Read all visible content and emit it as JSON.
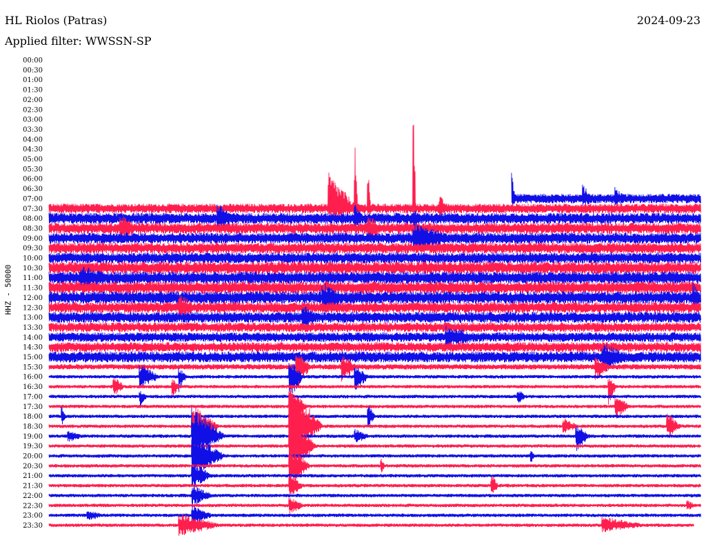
{
  "header": {
    "station": "HL Riolos (Patras)",
    "filter": "Applied filter: WWSSN-SP",
    "date": "2024-09-23"
  },
  "axis_label": "HHZ - 50000",
  "colors": {
    "odd_rows": "#ff1f4f",
    "even_rows": "#1010e6",
    "background": "#ffffff",
    "text": "#000000"
  },
  "chart_data": {
    "type": "line",
    "subtype": "helicorder",
    "title": "HL Riolos (Patras)",
    "subtitle": "Applied filter: WWSSN-SP",
    "date": "2024-09-23",
    "ylabel": "HHZ - 50000",
    "rows": [
      {
        "label": "00:00",
        "active": false,
        "amp": 0,
        "events": []
      },
      {
        "label": "00:30",
        "active": false,
        "amp": 0,
        "events": []
      },
      {
        "label": "01:00",
        "active": false,
        "amp": 0,
        "events": []
      },
      {
        "label": "01:30",
        "active": false,
        "amp": 0,
        "events": []
      },
      {
        "label": "02:00",
        "active": false,
        "amp": 0,
        "events": []
      },
      {
        "label": "02:30",
        "active": false,
        "amp": 0,
        "events": []
      },
      {
        "label": "03:00",
        "active": false,
        "amp": 0,
        "events": []
      },
      {
        "label": "03:30",
        "active": false,
        "amp": 0,
        "events": []
      },
      {
        "label": "04:00",
        "active": false,
        "amp": 0,
        "events": []
      },
      {
        "label": "04:30",
        "active": false,
        "amp": 0,
        "events": []
      },
      {
        "label": "05:00",
        "active": false,
        "amp": 0,
        "events": []
      },
      {
        "label": "05:30",
        "active": false,
        "amp": 0,
        "events": []
      },
      {
        "label": "06:00",
        "active": false,
        "amp": 0,
        "events": []
      },
      {
        "label": "06:30",
        "active": false,
        "amp": 0,
        "events": []
      },
      {
        "label": "07:00",
        "active": true,
        "start": 0.71,
        "amp": 7,
        "events": [
          {
            "t": 0.71,
            "up": 40,
            "down": 4,
            "dur": 0.005
          },
          {
            "t": 0.82,
            "up": 14,
            "down": 4,
            "dur": 0.01
          },
          {
            "t": 0.87,
            "up": 10,
            "down": 4,
            "dur": 0.01
          }
        ]
      },
      {
        "label": "07:30",
        "active": true,
        "amp": 7,
        "events": [
          {
            "t": 0.43,
            "up": 45,
            "down": 8,
            "dur": 0.04
          },
          {
            "t": 0.47,
            "up": 82,
            "down": 6,
            "dur": 0.004
          },
          {
            "t": 0.49,
            "up": 56,
            "down": 6,
            "dur": 0.004
          },
          {
            "t": 0.56,
            "up": 145,
            "down": 6,
            "dur": 0.003
          },
          {
            "t": 0.6,
            "up": 12,
            "down": 6,
            "dur": 0.01
          }
        ]
      },
      {
        "label": "08:00",
        "active": true,
        "amp": 8,
        "events": [
          {
            "t": 0.26,
            "up": 14,
            "down": 12,
            "dur": 0.02
          },
          {
            "t": 0.47,
            "up": 12,
            "down": 14,
            "dur": 0.01
          },
          {
            "t": 0.56,
            "up": 10,
            "down": 40,
            "dur": 0.005
          }
        ]
      },
      {
        "label": "08:30",
        "active": true,
        "amp": 8,
        "events": [
          {
            "t": 0.11,
            "up": 12,
            "down": 12,
            "dur": 0.02
          },
          {
            "t": 0.49,
            "up": 10,
            "down": 10,
            "dur": 0.02
          }
        ]
      },
      {
        "label": "09:00",
        "active": true,
        "amp": 8,
        "events": [
          {
            "t": 0.56,
            "up": 14,
            "down": 14,
            "dur": 0.05
          }
        ]
      },
      {
        "label": "09:30",
        "active": true,
        "amp": 8,
        "events": []
      },
      {
        "label": "10:00",
        "active": true,
        "amp": 8,
        "events": []
      },
      {
        "label": "10:30",
        "active": true,
        "amp": 9,
        "events": []
      },
      {
        "label": "11:00",
        "active": true,
        "amp": 9,
        "events": [
          {
            "t": 0.05,
            "up": 10,
            "down": 10,
            "dur": 0.03
          }
        ]
      },
      {
        "label": "11:30",
        "active": true,
        "amp": 9,
        "events": []
      },
      {
        "label": "12:00",
        "active": true,
        "amp": 9,
        "events": [
          {
            "t": 0.42,
            "up": 14,
            "down": 18,
            "dur": 0.03
          },
          {
            "t": 0.99,
            "up": 12,
            "down": 14,
            "dur": 0.01
          }
        ]
      },
      {
        "label": "12:30",
        "active": true,
        "amp": 8,
        "events": [
          {
            "t": 0.2,
            "up": 12,
            "down": 10,
            "dur": 0.02
          }
        ]
      },
      {
        "label": "13:00",
        "active": true,
        "amp": 8,
        "events": [
          {
            "t": 0.39,
            "up": 10,
            "down": 12,
            "dur": 0.02
          }
        ]
      },
      {
        "label": "13:30",
        "active": true,
        "amp": 7,
        "events": []
      },
      {
        "label": "14:00",
        "active": true,
        "amp": 7,
        "events": [
          {
            "t": 0.61,
            "up": 10,
            "down": 8,
            "dur": 0.04
          }
        ]
      },
      {
        "label": "14:30",
        "active": true,
        "amp": 7,
        "events": []
      },
      {
        "label": "15:00",
        "active": true,
        "amp": 8,
        "events": [
          {
            "t": 0.85,
            "up": 14,
            "down": 18,
            "dur": 0.03
          }
        ]
      },
      {
        "label": "15:30",
        "active": true,
        "amp": 4,
        "events": [
          {
            "t": 0.38,
            "up": 22,
            "down": 32,
            "dur": 0.02
          },
          {
            "t": 0.45,
            "up": 14,
            "down": 18,
            "dur": 0.02
          },
          {
            "t": 0.84,
            "up": 10,
            "down": 16,
            "dur": 0.02
          }
        ]
      },
      {
        "label": "16:00",
        "active": true,
        "amp": 2.5,
        "events": [
          {
            "t": 0.14,
            "up": 16,
            "down": 14,
            "dur": 0.03
          },
          {
            "t": 0.2,
            "up": 12,
            "down": 20,
            "dur": 0.01
          },
          {
            "t": 0.37,
            "up": 24,
            "down": 30,
            "dur": 0.02
          },
          {
            "t": 0.47,
            "up": 14,
            "down": 20,
            "dur": 0.02
          }
        ]
      },
      {
        "label": "16:30",
        "active": true,
        "amp": 2.5,
        "events": [
          {
            "t": 0.1,
            "up": 14,
            "down": 10,
            "dur": 0.015
          },
          {
            "t": 0.19,
            "up": 10,
            "down": 12,
            "dur": 0.01
          },
          {
            "t": 0.86,
            "up": 12,
            "down": 24,
            "dur": 0.01
          }
        ]
      },
      {
        "label": "17:00",
        "active": true,
        "amp": 2.5,
        "events": [
          {
            "t": 0.14,
            "up": 6,
            "down": 12,
            "dur": 0.01
          },
          {
            "t": 0.72,
            "up": 10,
            "down": 10,
            "dur": 0.01
          }
        ]
      },
      {
        "label": "17:30",
        "active": true,
        "amp": 2.5,
        "events": [
          {
            "t": 0.37,
            "up": 22,
            "down": 30,
            "dur": 0.025
          },
          {
            "t": 0.87,
            "up": 16,
            "down": 16,
            "dur": 0.02
          }
        ]
      },
      {
        "label": "18:00",
        "active": true,
        "amp": 2.5,
        "events": [
          {
            "t": 0.02,
            "up": 12,
            "down": 12,
            "dur": 0.005
          },
          {
            "t": 0.49,
            "up": 16,
            "down": 14,
            "dur": 0.01
          }
        ]
      },
      {
        "label": "18:30",
        "active": true,
        "amp": 2.5,
        "events": [
          {
            "t": 0.22,
            "up": 30,
            "down": 24,
            "dur": 0.04
          },
          {
            "t": 0.37,
            "up": 60,
            "down": 40,
            "dur": 0.05
          },
          {
            "t": 0.79,
            "up": 10,
            "down": 8,
            "dur": 0.02
          },
          {
            "t": 0.95,
            "up": 16,
            "down": 14,
            "dur": 0.02
          }
        ]
      },
      {
        "label": "19:00",
        "active": true,
        "amp": 2.5,
        "events": [
          {
            "t": 0.03,
            "up": 6,
            "down": 6,
            "dur": 0.02
          },
          {
            "t": 0.22,
            "up": 40,
            "down": 30,
            "dur": 0.05
          },
          {
            "t": 0.47,
            "up": 8,
            "down": 8,
            "dur": 0.02
          },
          {
            "t": 0.81,
            "up": 14,
            "down": 20,
            "dur": 0.02
          }
        ]
      },
      {
        "label": "19:30",
        "active": true,
        "amp": 2.5,
        "events": [
          {
            "t": 0.37,
            "up": 40,
            "down": 40,
            "dur": 0.04
          }
        ]
      },
      {
        "label": "20:00",
        "active": true,
        "amp": 2.5,
        "events": [
          {
            "t": 0.22,
            "up": 30,
            "down": 30,
            "dur": 0.05
          },
          {
            "t": 0.74,
            "up": 8,
            "down": 8,
            "dur": 0.005
          }
        ]
      },
      {
        "label": "20:30",
        "active": true,
        "amp": 2.5,
        "events": [
          {
            "t": 0.37,
            "up": 24,
            "down": 30,
            "dur": 0.03
          },
          {
            "t": 0.51,
            "up": 8,
            "down": 8,
            "dur": 0.005
          }
        ]
      },
      {
        "label": "21:00",
        "active": true,
        "amp": 2.5,
        "events": [
          {
            "t": 0.22,
            "up": 20,
            "down": 16,
            "dur": 0.03
          }
        ]
      },
      {
        "label": "21:30",
        "active": true,
        "amp": 2.5,
        "events": [
          {
            "t": 0.37,
            "up": 14,
            "down": 16,
            "dur": 0.02
          },
          {
            "t": 0.68,
            "up": 14,
            "down": 12,
            "dur": 0.01
          }
        ]
      },
      {
        "label": "22:00",
        "active": true,
        "amp": 2.5,
        "events": [
          {
            "t": 0.22,
            "up": 14,
            "down": 12,
            "dur": 0.03
          }
        ]
      },
      {
        "label": "22:30",
        "active": true,
        "amp": 2.5,
        "events": [
          {
            "t": 0.37,
            "up": 10,
            "down": 10,
            "dur": 0.02
          },
          {
            "t": 0.98,
            "up": 6,
            "down": 6,
            "dur": 0.01
          }
        ]
      },
      {
        "label": "23:00",
        "active": true,
        "amp": 2.5,
        "events": [
          {
            "t": 0.06,
            "up": 6,
            "down": 6,
            "dur": 0.02
          },
          {
            "t": 0.22,
            "up": 12,
            "down": 12,
            "dur": 0.03
          }
        ]
      },
      {
        "label": "23:30",
        "active": true,
        "end": 0.99,
        "amp": 2.5,
        "events": [
          {
            "t": 0.2,
            "up": 16,
            "down": 14,
            "dur": 0.06
          },
          {
            "t": 0.85,
            "up": 10,
            "down": 8,
            "dur": 0.06
          }
        ]
      }
    ]
  }
}
